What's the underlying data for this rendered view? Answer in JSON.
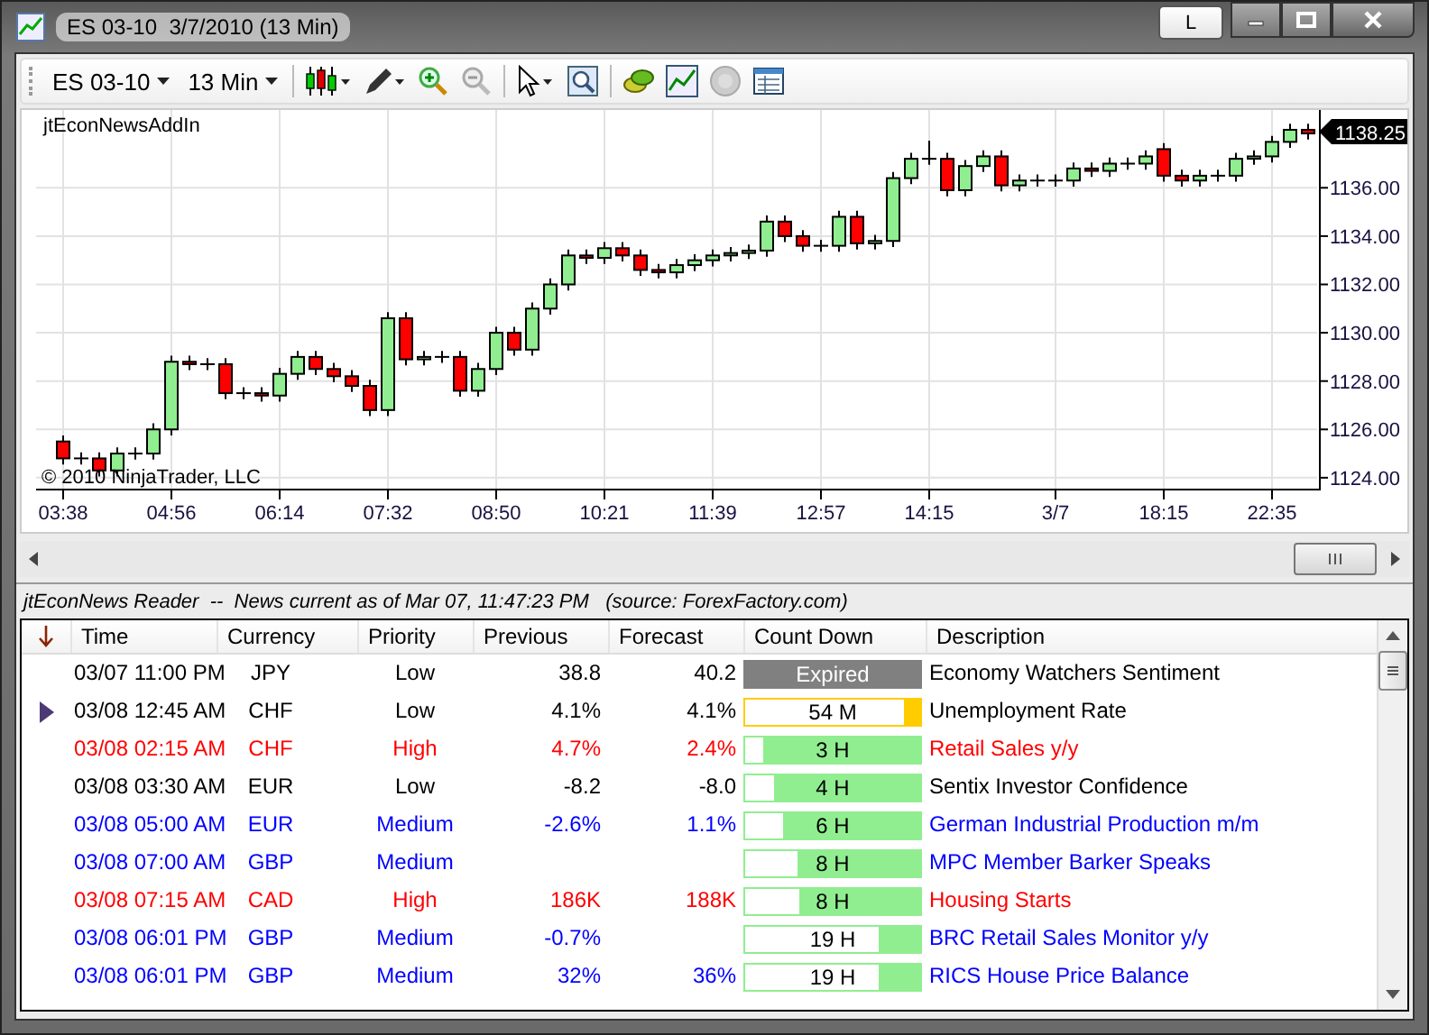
{
  "window": {
    "title": "ES 03-10  3/7/2010 (13 Min)",
    "link_button": "L"
  },
  "toolbar": {
    "instrument": "ES 03-10",
    "interval": "13 Min"
  },
  "chart": {
    "indicator_label": "jtEconNewsAddIn",
    "copyright": "© 2010 NinjaTrader, LLC",
    "last_price": "1138.25",
    "chart_data": {
      "type": "candlestick",
      "categories": [
        "03:38",
        null,
        null,
        null,
        null,
        null,
        "04:56",
        null,
        null,
        null,
        null,
        null,
        "06:14",
        null,
        null,
        null,
        null,
        null,
        "07:32",
        null,
        null,
        null,
        null,
        null,
        "08:50",
        null,
        null,
        null,
        null,
        null,
        "10:21",
        null,
        null,
        null,
        null,
        null,
        "11:39",
        null,
        null,
        null,
        null,
        null,
        "12:57",
        null,
        null,
        null,
        null,
        null,
        "14:15",
        null,
        null,
        null,
        null,
        null,
        null,
        "3/7",
        null,
        null,
        null,
        null,
        null,
        "18:15",
        null,
        null,
        null,
        null,
        null,
        "22:35",
        null,
        null
      ],
      "ylim": [
        1123.51,
        1139.22
      ],
      "grid": true,
      "ohlc": [
        [
          1125.5,
          1125.75,
          1124.55,
          1124.8
        ],
        [
          1124.8,
          1125.05,
          1124.55,
          1124.8
        ],
        [
          1124.8,
          1125.05,
          1124.05,
          1124.3
        ],
        [
          1124.3,
          1125.25,
          1124.05,
          1125.0
        ],
        [
          1125.0,
          1125.25,
          1124.75,
          1125.0
        ],
        [
          1125.0,
          1126.25,
          1124.75,
          1126.0
        ],
        [
          1126.0,
          1129.05,
          1125.75,
          1128.8
        ],
        [
          1128.8,
          1129.05,
          1128.45,
          1128.7
        ],
        [
          1128.7,
          1128.95,
          1128.45,
          1128.7
        ],
        [
          1128.7,
          1128.95,
          1127.25,
          1127.5
        ],
        [
          1127.5,
          1127.75,
          1127.25,
          1127.5
        ],
        [
          1127.5,
          1127.75,
          1127.15,
          1127.4
        ],
        [
          1127.4,
          1128.55,
          1127.15,
          1128.3
        ],
        [
          1128.3,
          1129.25,
          1128.05,
          1129.0
        ],
        [
          1129.0,
          1129.25,
          1128.25,
          1128.5
        ],
        [
          1128.5,
          1128.75,
          1127.95,
          1128.2
        ],
        [
          1128.2,
          1128.45,
          1127.55,
          1127.8
        ],
        [
          1127.8,
          1128.05,
          1126.55,
          1126.8
        ],
        [
          1126.8,
          1130.85,
          1126.55,
          1130.6
        ],
        [
          1130.6,
          1130.85,
          1128.65,
          1128.9
        ],
        [
          1128.9,
          1129.25,
          1128.65,
          1129.0
        ],
        [
          1129.0,
          1129.25,
          1128.75,
          1129.0
        ],
        [
          1129.0,
          1129.25,
          1127.35,
          1127.6
        ],
        [
          1127.6,
          1128.75,
          1127.35,
          1128.5
        ],
        [
          1128.5,
          1130.25,
          1128.25,
          1130.0
        ],
        [
          1130.0,
          1130.25,
          1129.05,
          1129.3
        ],
        [
          1129.3,
          1131.25,
          1129.05,
          1131.0
        ],
        [
          1131.0,
          1132.25,
          1130.75,
          1132.0
        ],
        [
          1132.0,
          1133.45,
          1131.75,
          1133.2
        ],
        [
          1133.2,
          1133.45,
          1132.85,
          1133.1
        ],
        [
          1133.1,
          1133.75,
          1132.85,
          1133.5
        ],
        [
          1133.5,
          1133.75,
          1132.95,
          1133.2
        ],
        [
          1133.2,
          1133.45,
          1132.35,
          1132.6
        ],
        [
          1132.6,
          1132.85,
          1132.25,
          1132.5
        ],
        [
          1132.5,
          1133.05,
          1132.25,
          1132.8
        ],
        [
          1132.8,
          1133.25,
          1132.55,
          1133.0
        ],
        [
          1133.0,
          1133.45,
          1132.75,
          1133.2
        ],
        [
          1133.2,
          1133.55,
          1132.95,
          1133.3
        ],
        [
          1133.3,
          1133.65,
          1133.05,
          1133.4
        ],
        [
          1133.4,
          1134.85,
          1133.15,
          1134.6
        ],
        [
          1134.6,
          1134.85,
          1133.75,
          1134.0
        ],
        [
          1134.0,
          1134.25,
          1133.35,
          1133.6
        ],
        [
          1133.6,
          1133.85,
          1133.35,
          1133.6
        ],
        [
          1133.6,
          1135.05,
          1133.35,
          1134.8
        ],
        [
          1134.8,
          1135.05,
          1133.45,
          1133.7
        ],
        [
          1133.7,
          1134.05,
          1133.45,
          1133.8
        ],
        [
          1133.8,
          1136.65,
          1133.55,
          1136.4
        ],
        [
          1136.4,
          1137.45,
          1136.15,
          1137.2
        ],
        [
          1137.2,
          1137.95,
          1136.95,
          1137.2
        ],
        [
          1137.2,
          1137.45,
          1135.65,
          1135.9
        ],
        [
          1135.9,
          1137.15,
          1135.65,
          1136.9
        ],
        [
          1136.9,
          1137.55,
          1136.65,
          1137.3
        ],
        [
          1137.3,
          1137.55,
          1135.85,
          1136.1
        ],
        [
          1136.1,
          1136.55,
          1135.85,
          1136.3
        ],
        [
          1136.3,
          1136.55,
          1136.05,
          1136.3
        ],
        [
          1136.3,
          1136.55,
          1136.05,
          1136.3
        ],
        [
          1136.3,
          1137.05,
          1136.05,
          1136.8
        ],
        [
          1136.8,
          1137.05,
          1136.45,
          1136.7
        ],
        [
          1136.7,
          1137.25,
          1136.45,
          1137.0
        ],
        [
          1137.0,
          1137.25,
          1136.75,
          1137.0
        ],
        [
          1137.0,
          1137.55,
          1136.75,
          1137.3
        ],
        [
          1137.6,
          1137.85,
          1136.25,
          1136.5
        ],
        [
          1136.5,
          1136.75,
          1136.05,
          1136.3
        ],
        [
          1136.3,
          1136.75,
          1136.05,
          1136.5
        ],
        [
          1136.5,
          1136.75,
          1136.25,
          1136.5
        ],
        [
          1136.5,
          1137.45,
          1136.25,
          1137.2
        ],
        [
          1137.2,
          1137.55,
          1136.95,
          1137.3
        ],
        [
          1137.3,
          1138.15,
          1137.05,
          1137.9
        ],
        [
          1137.9,
          1138.65,
          1137.65,
          1138.4
        ],
        [
          1138.4,
          1138.65,
          1138.0,
          1138.25
        ]
      ],
      "yticks": [
        {
          "value": 1136,
          "label": "1136.00"
        },
        {
          "value": 1134,
          "label": "1134.00"
        },
        {
          "value": 1132,
          "label": "1132.00"
        },
        {
          "value": 1130,
          "label": "1130.00"
        },
        {
          "value": 1128,
          "label": "1128.00"
        },
        {
          "value": 1126,
          "label": "1126.00"
        },
        {
          "value": 1124,
          "label": "1124.00"
        }
      ]
    }
  },
  "reader": {
    "status": "jtEconNews Reader  --  News current as of Mar 07, 11:47:23 PM   (source: ForexFactory.com)",
    "columns": [
      "Time",
      "Currency",
      "Priority",
      "Previous",
      "Forecast",
      "Count Down",
      "Description"
    ],
    "rows": [
      {
        "time": "03/07 11:00 PM",
        "currency": "JPY",
        "priority": "Low",
        "previous": "38.8",
        "forecast": "40.2",
        "countdown": {
          "text": "Expired",
          "color": "#808080"
        },
        "description": "Economy Watchers Sentiment",
        "color": "#000000",
        "current": false
      },
      {
        "time": "03/08 12:45 AM",
        "currency": "CHF",
        "priority": "Low",
        "previous": "4.1%",
        "forecast": "4.1%",
        "countdown": {
          "text": "54 M",
          "color": "#ffcc00",
          "level": 0.09
        },
        "description": "Unemployment Rate",
        "color": "#000000",
        "current": true
      },
      {
        "time": "03/08 02:15 AM",
        "currency": "CHF",
        "priority": "High",
        "previous": "4.7%",
        "forecast": "2.4%",
        "countdown": {
          "text": "3 H",
          "color": "#90ee90",
          "level": 0.9
        },
        "description": "Retail Sales y/y",
        "color": "#ff0000",
        "current": false
      },
      {
        "time": "03/08 03:30 AM",
        "currency": "EUR",
        "priority": "Low",
        "previous": "-8.2",
        "forecast": "-8.0",
        "countdown": {
          "text": "4 H",
          "color": "#90ee90",
          "level": 0.84
        },
        "description": "Sentix Investor Confidence",
        "color": "#000000",
        "current": false
      },
      {
        "time": "03/08 05:00 AM",
        "currency": "EUR",
        "priority": "Medium",
        "previous": "-2.6%",
        "forecast": "1.1%",
        "countdown": {
          "text": "6 H",
          "color": "#90ee90",
          "level": 0.78
        },
        "description": "German Industrial Production m/m",
        "color": "#0000ff",
        "current": false
      },
      {
        "time": "03/08 07:00 AM",
        "currency": "GBP",
        "priority": "Medium",
        "countdown": {
          "text": "8 H",
          "color": "#90ee90",
          "level": 0.7
        },
        "description": "MPC Member Barker Speaks",
        "color": "#0000ff",
        "current": false
      },
      {
        "time": "03/08 07:15 AM",
        "currency": "CAD",
        "priority": "High",
        "previous": "186K",
        "forecast": "188K",
        "countdown": {
          "text": "8 H",
          "color": "#90ee90",
          "level": 0.69
        },
        "description": "Housing Starts",
        "color": "#ff0000",
        "current": false
      },
      {
        "time": "03/08 06:01 PM",
        "currency": "GBP",
        "priority": "Medium",
        "previous": "-0.7%",
        "countdown": {
          "text": "19 H",
          "color": "#90ee90",
          "level": 0.24
        },
        "description": "BRC Retail Sales Monitor y/y",
        "color": "#0000ff",
        "current": false
      },
      {
        "time": "03/08 06:01 PM",
        "currency": "GBP",
        "priority": "Medium",
        "previous": "32%",
        "forecast": "36%",
        "countdown": {
          "text": "19 H",
          "color": "#90ee90",
          "level": 0.24
        },
        "description": "RICS House Price Balance",
        "color": "#0000ff",
        "current": false
      }
    ]
  }
}
